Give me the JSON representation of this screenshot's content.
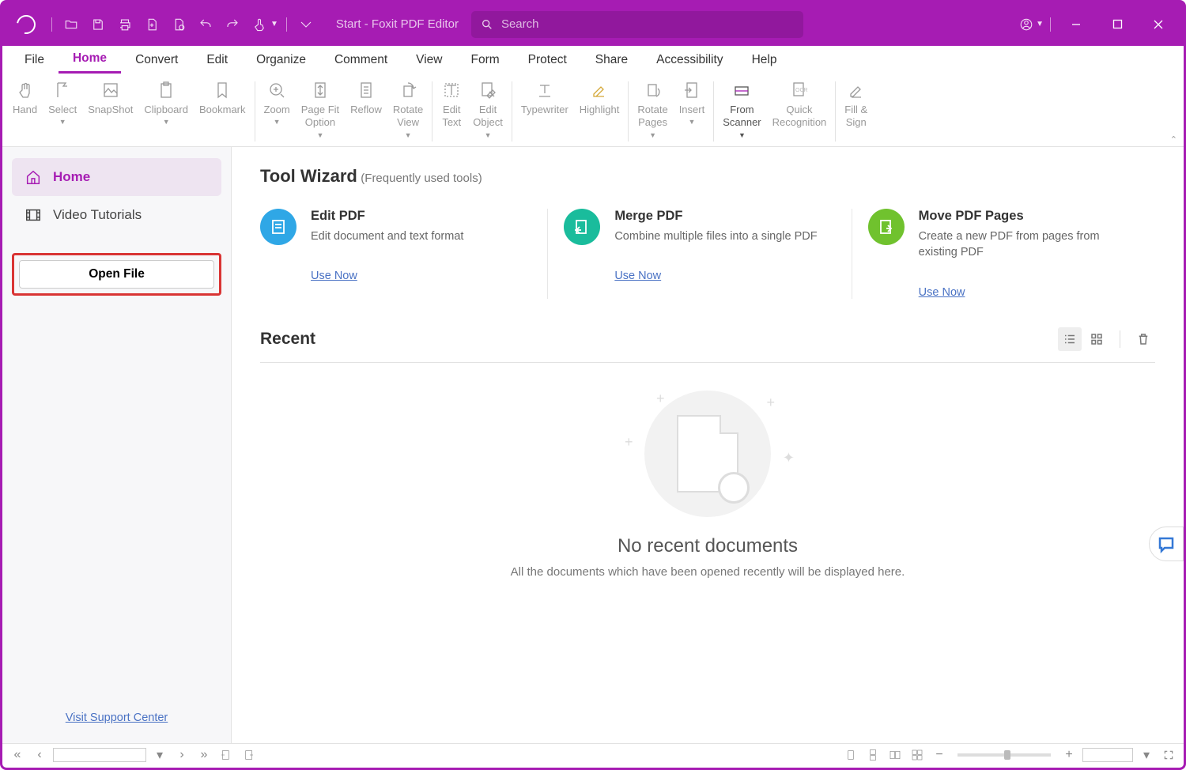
{
  "title": "Start - Foxit PDF Editor",
  "search": {
    "placeholder": "Search"
  },
  "menu": {
    "tabs": [
      "File",
      "Home",
      "Convert",
      "Edit",
      "Organize",
      "Comment",
      "View",
      "Form",
      "Protect",
      "Share",
      "Accessibility",
      "Help"
    ],
    "active": 1
  },
  "ribbon": {
    "hand": "Hand",
    "select": "Select",
    "snapshot": "SnapShot",
    "clipboard": "Clipboard",
    "bookmark": "Bookmark",
    "zoom": "Zoom",
    "pagefit": "Page Fit\nOption",
    "reflow": "Reflow",
    "rotview": "Rotate\nView",
    "edittext": "Edit\nText",
    "editobj": "Edit\nObject",
    "typewriter": "Typewriter",
    "highlight": "Highlight",
    "rotpages": "Rotate\nPages",
    "insert": "Insert",
    "scanner": "From\nScanner",
    "ocr": "Quick\nRecognition",
    "fillsign": "Fill &\nSign"
  },
  "sidebar": {
    "home": "Home",
    "video": "Video Tutorials",
    "openfile": "Open File",
    "support": "Visit Support Center"
  },
  "wizard": {
    "title": "Tool Wizard",
    "subtitle": "(Frequently used tools)",
    "cards": [
      {
        "title": "Edit PDF",
        "desc": "Edit document and text format",
        "use": "Use Now",
        "color": "#2fa7e6"
      },
      {
        "title": "Merge PDF",
        "desc": "Combine multiple files into a single PDF",
        "use": "Use Now",
        "color": "#1abc9c"
      },
      {
        "title": "Move PDF Pages",
        "desc": "Create a new PDF from pages from existing PDF",
        "use": "Use Now",
        "color": "#70c22e"
      }
    ]
  },
  "recent": {
    "title": "Recent",
    "empty_big": "No recent documents",
    "empty_small": "All the documents which have been opened recently will be displayed here."
  }
}
